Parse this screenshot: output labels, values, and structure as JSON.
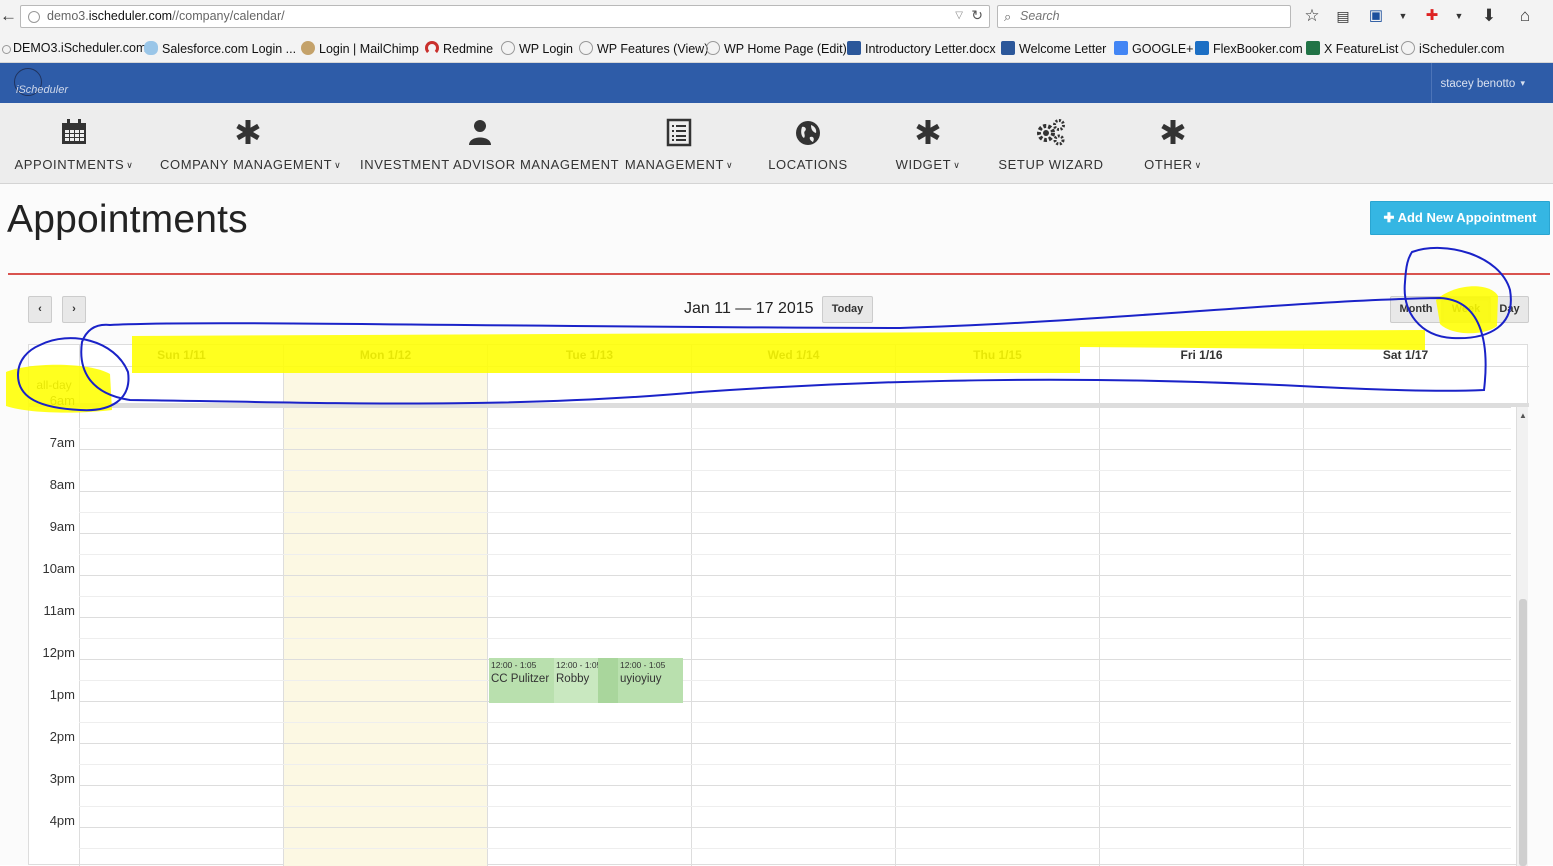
{
  "browser": {
    "url_prefix": "demo3.",
    "url_host": "ischeduler.com",
    "url_path": "//company/calendar/",
    "search_placeholder": "Search"
  },
  "bookmarks": [
    {
      "label": "DEMO3.iScheduler.com",
      "icon": "globe-icon",
      "color": "#8a8a8a"
    },
    {
      "label": "Salesforce.com Login ...",
      "icon": "cloud-icon",
      "color": "#9ac6e8"
    },
    {
      "label": "Login | MailChimp",
      "icon": "mailchimp-icon",
      "color": "#c4a26a"
    },
    {
      "label": "Redmine",
      "icon": "redmine-icon",
      "color": "#c9302c"
    },
    {
      "label": "WP Login",
      "icon": "check-icon",
      "color": "#8a8a8a"
    },
    {
      "label": "WP Features (View)",
      "icon": "check-icon",
      "color": "#8a8a8a"
    },
    {
      "label": "WP Home Page (Edit)",
      "icon": "check-icon",
      "color": "#8a8a8a"
    },
    {
      "label": "Introductory Letter.docx",
      "icon": "word-icon",
      "color": "#2b579a"
    },
    {
      "label": "Welcome Letter",
      "icon": "word-icon",
      "color": "#2b579a"
    },
    {
      "label": "GOOGLE+",
      "icon": "google-icon",
      "color": "#4285f4"
    },
    {
      "label": "FlexBooker.com",
      "icon": "flexbooker-icon",
      "color": "#1c6fc4"
    },
    {
      "label": "X FeatureList",
      "icon": "excel-icon",
      "color": "#217346"
    },
    {
      "label": "iScheduler.com",
      "icon": "check-icon",
      "color": "#8a8a8a"
    }
  ],
  "app": {
    "logo_text": "iScheduler",
    "user_name": "stacey benotto",
    "brand_color": "#2e5ca8"
  },
  "nav": [
    {
      "label": "APPOINTMENTS",
      "icon": "calendar-icon",
      "dropdown": true
    },
    {
      "label": "COMPANY MANAGEMENT",
      "icon": "asterisk-icon",
      "dropdown": true
    },
    {
      "label": "INVESTMENT ADVISOR MANAGEMENT",
      "icon": "user-icon",
      "dropdown": false
    },
    {
      "label": "MANAGEMENT",
      "icon": "list-icon",
      "dropdown": true
    },
    {
      "label": "LOCATIONS",
      "icon": "globe-icon",
      "dropdown": false
    },
    {
      "label": "WIDGET",
      "icon": "asterisk-icon",
      "dropdown": true
    },
    {
      "label": "SETUP WIZARD",
      "icon": "gears-icon",
      "dropdown": false
    },
    {
      "label": "OTHER",
      "icon": "asterisk-icon",
      "dropdown": true
    }
  ],
  "page": {
    "title": "Appointments",
    "add_button": "Add New Appointment",
    "accent": "#35b6e3",
    "rule_color": "#d9534f"
  },
  "calendar": {
    "prev": "‹",
    "next": "›",
    "range_title": "Jan 11 — 17 2015",
    "today": "Today",
    "views": {
      "month": "Month",
      "week": "Week",
      "day": "Day"
    },
    "active_view": "Week",
    "days": [
      "Sun 1/11",
      "Mon 1/12",
      "Tue 1/13",
      "Wed 1/14",
      "Thu 1/15",
      "Fri 1/16",
      "Sat 1/17"
    ],
    "today_column": "Mon 1/12",
    "allday_label": "all-day",
    "hours": [
      "6am",
      "7am",
      "8am",
      "9am",
      "10am",
      "11am",
      "12pm",
      "1pm",
      "2pm",
      "3pm",
      "4pm"
    ],
    "events": [
      {
        "day": "Tue 1/13",
        "time": "12:00 - 1:05",
        "title": "CC Pulitzer"
      },
      {
        "day": "Tue 1/13",
        "time": "12:00 - 1:05",
        "title": "Robby"
      },
      {
        "day": "Tue 1/13",
        "time": "12:00 - 1:05",
        "title": "uyioyiuy"
      }
    ],
    "event_color": "#b9e0ae",
    "today_color": "#fcf8e3"
  },
  "annotations": {
    "highlight_color": "#ffff00",
    "ink_color": "#1a22c8"
  }
}
